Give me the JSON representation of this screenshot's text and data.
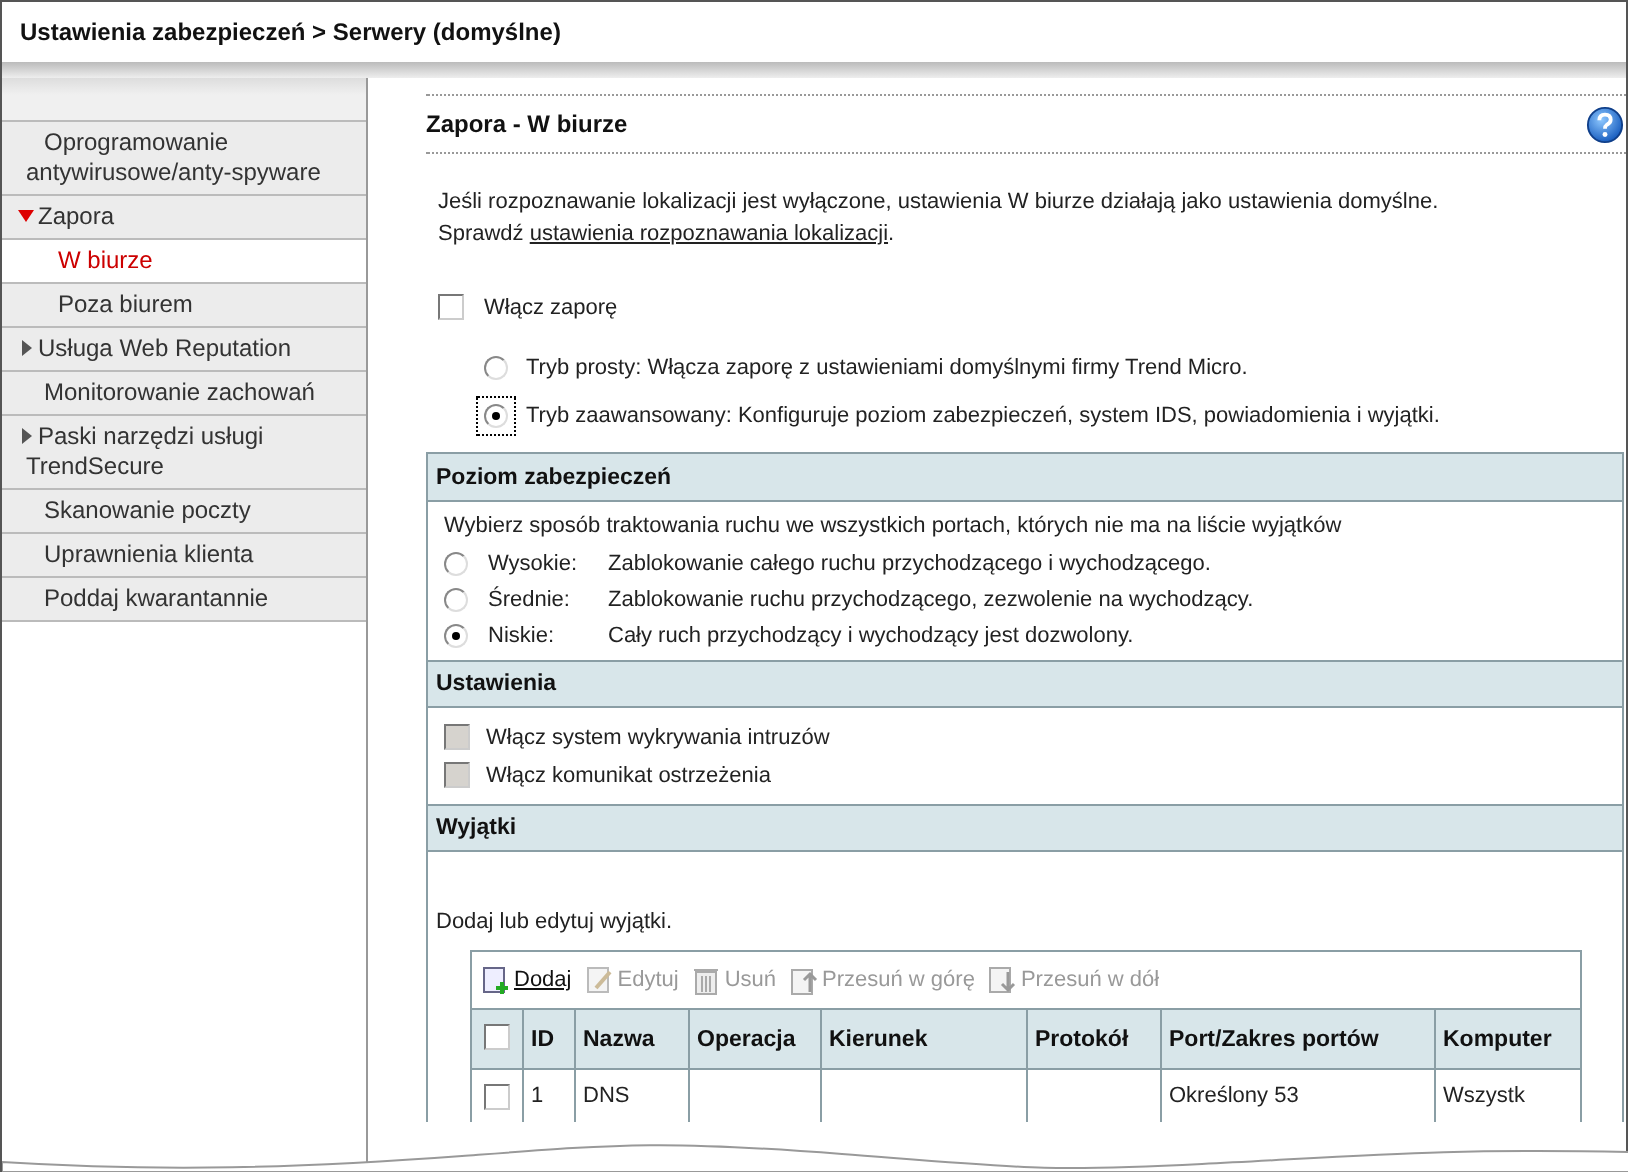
{
  "header": {
    "title": "Ustawienia zabezpieczeń > Serwery (domyślne)"
  },
  "sidebar": {
    "items": [
      {
        "label": "Oprogramowanie antywirusowe/anty-spyware",
        "kind": "plain",
        "selected": false
      },
      {
        "label": "Zapora",
        "kind": "group",
        "expanded": true,
        "selected": false
      },
      {
        "label": "W biurze",
        "kind": "sub",
        "selected": true
      },
      {
        "label": "Poza biurem",
        "kind": "sub",
        "selected": false
      },
      {
        "label": "Usługa Web Reputation",
        "kind": "group",
        "expanded": false,
        "selected": false
      },
      {
        "label": "Monitorowanie zachowań",
        "kind": "plain",
        "selected": false
      },
      {
        "label": "Paski narzędzi usługi TrendSecure",
        "kind": "group",
        "expanded": false,
        "selected": false
      },
      {
        "label": "Skanowanie poczty",
        "kind": "plain",
        "selected": false
      },
      {
        "label": "Uprawnienia klienta",
        "kind": "plain",
        "selected": false
      },
      {
        "label": "Poddaj kwarantannie",
        "kind": "plain",
        "selected": false
      }
    ]
  },
  "panel": {
    "title": "Zapora - W biurze",
    "info": "Jeśli rozpoznawanie lokalizacji jest wyłączone, ustawienia W biurze działają jako ustawienia domyślne.",
    "info_link": {
      "prefix": "Sprawdź",
      "link": "ustawienia rozpoznawania lokalizacji",
      "suffix": "."
    },
    "enable_firewall": {
      "label": "Włącz zaporę",
      "checked": false
    },
    "modes": [
      {
        "label": "Tryb prosty: Włącza zaporę z ustawieniami domyślnymi firmy Trend Micro.",
        "selected": false,
        "focused": false
      },
      {
        "label": "Tryb zaawansowany: Konfiguruje poziom zabezpieczeń, system IDS, powiadomienia i wyjątki.",
        "selected": true,
        "focused": true
      }
    ]
  },
  "security_level": {
    "title": "Poziom zabezpieczeń",
    "description": "Wybierz sposób traktowania ruchu we wszystkich portach, których nie ma na liście wyjątków",
    "options": [
      {
        "label": "Wysokie:",
        "description": "Zablokowanie całego ruchu przychodzącego i wychodzącego.",
        "selected": false
      },
      {
        "label": "Średnie:",
        "description": "Zablokowanie ruchu przychodzącego, zezwolenie na wychodzący.",
        "selected": false
      },
      {
        "label": "Niskie:",
        "description": "Cały ruch przychodzący i wychodzący jest dozwolony.",
        "selected": true
      }
    ]
  },
  "settings": {
    "title": "Ustawienia",
    "options": [
      {
        "label": "Włącz system wykrywania intruzów",
        "checked": false,
        "disabled": true
      },
      {
        "label": "Włącz komunikat ostrzeżenia",
        "checked": false,
        "disabled": true
      }
    ]
  },
  "exceptions": {
    "title": "Wyjątki",
    "description": "Dodaj lub edytuj wyjątki.",
    "toolbar": [
      {
        "kind": "add",
        "label": "Dodaj",
        "disabled": false
      },
      {
        "kind": "edit",
        "label": "Edytuj",
        "disabled": true
      },
      {
        "kind": "delete",
        "label": "Usuń",
        "disabled": true
      },
      {
        "kind": "up",
        "label": "Przesuń w górę",
        "disabled": true
      },
      {
        "kind": "down",
        "label": "Przesuń w dół",
        "disabled": true
      }
    ],
    "table": {
      "select_all": {
        "checked": false
      },
      "columns": [
        "ID",
        "Nazwa",
        "Operacja",
        "Kierunek",
        "Protokół",
        "Port/Zakres portów",
        "Komputer"
      ],
      "rows": [
        {
          "checked": false,
          "cells": [
            "1",
            "DNS",
            "",
            "",
            "",
            "Określony 53",
            "Wszystk"
          ]
        }
      ]
    }
  }
}
